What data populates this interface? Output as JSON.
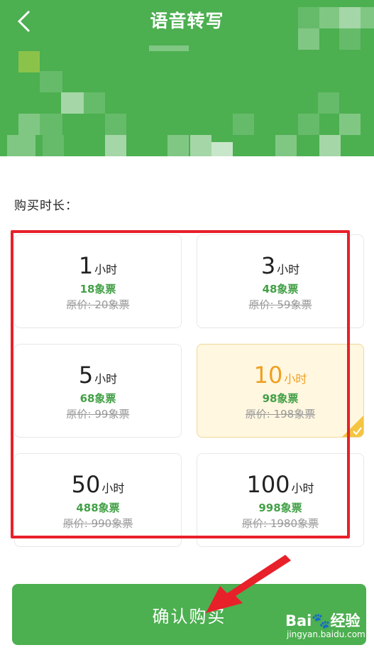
{
  "header": {
    "title": "语音转写",
    "back_icon": "chevron-left-icon"
  },
  "section_label": "购买时长：",
  "plans": [
    {
      "num": "1",
      "unit": "小时",
      "price": "18象票",
      "original": "原价: 20象票"
    },
    {
      "num": "3",
      "unit": "小时",
      "price": "48象票",
      "original": "原价: 59象票"
    },
    {
      "num": "5",
      "unit": "小时",
      "price": "68象票",
      "original": "原价: 99象票"
    },
    {
      "num": "10",
      "unit": "小时",
      "price": "98象票",
      "original": "原价: 198象票",
      "selected": true
    },
    {
      "num": "50",
      "unit": "小时",
      "price": "488象票",
      "original": "原价: 990象票"
    },
    {
      "num": "100",
      "unit": "小时",
      "price": "998象票",
      "original": "原价: 1980象票"
    }
  ],
  "confirm_label": "确认购买",
  "watermark": {
    "logo": "Bai🐾经验",
    "url": "jingyan.baidu.com"
  },
  "colors": {
    "brand_green": "#4caf50",
    "price_green": "#43a047",
    "selected_orange": "#f0a020",
    "selected_bg": "#fff7e0",
    "highlight_red": "#e8202a"
  }
}
